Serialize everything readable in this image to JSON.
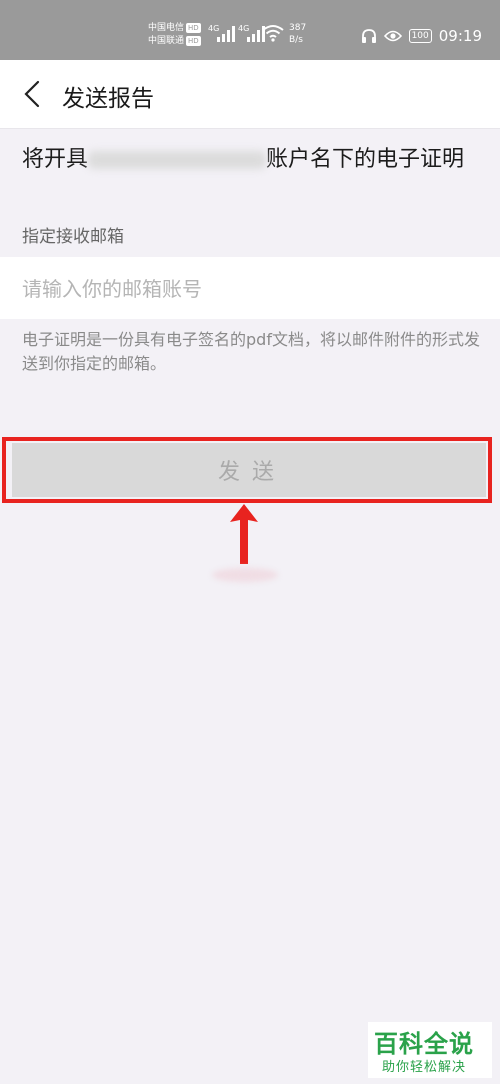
{
  "status_bar": {
    "carrier1": "中国电信",
    "carrier2": "中国联通",
    "hd": "HD",
    "net1": "4G",
    "net2": "4G",
    "speed_value": "387",
    "speed_unit": "B/s",
    "battery": "100",
    "time": "09:19"
  },
  "header": {
    "back_icon": "chevron-left-icon",
    "title": "发送报告"
  },
  "statement": {
    "prefix": "将开具",
    "suffix": "账户名下的电子证明"
  },
  "email": {
    "label": "指定接收邮箱",
    "placeholder": "请输入你的邮箱账号",
    "value": ""
  },
  "description": "电子证明是一份具有电子签名的pdf文档，将以邮件附件的形式发送到你指定的邮箱。",
  "send_button": {
    "label": "发送",
    "enabled": false
  },
  "annotation": {
    "highlight_color": "#e8231f",
    "arrow_color": "#e8231f"
  },
  "watermark": {
    "title": "百科全说",
    "subtitle": "助你轻松解决"
  }
}
